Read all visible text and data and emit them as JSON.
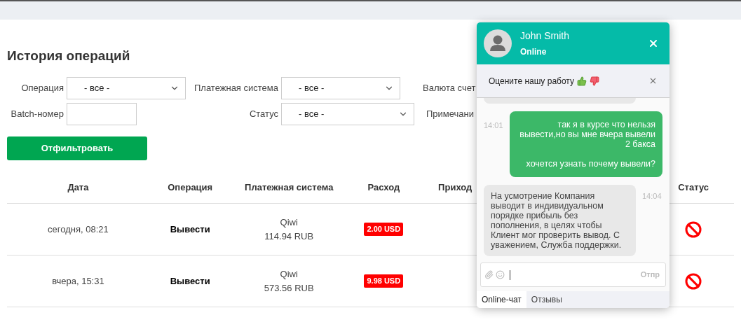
{
  "page": {
    "title": "История операций"
  },
  "filters": [
    {
      "label": "Операция",
      "kind": "select",
      "value": "- все -"
    },
    {
      "label": "Платежная система",
      "kind": "select",
      "value": "- все -"
    },
    {
      "label": "Валюта счет",
      "kind": "cut"
    },
    {
      "label": "Batch-номер",
      "kind": "input"
    },
    {
      "label": "Статус",
      "kind": "select",
      "value": "- все -"
    },
    {
      "label": "Примечани",
      "kind": "cut"
    }
  ],
  "filter_button": "Отфильтровать",
  "table": {
    "columns": [
      "Дата",
      "Операция",
      "Платежная система",
      "Расход",
      "Приход",
      "Статус"
    ],
    "rows": [
      {
        "date": "сегодня, 08:21",
        "operation": "Вывести",
        "system": "Qiwi",
        "system_amount": "114.94 RUB",
        "expense": "2.00 USD",
        "rejected": true
      },
      {
        "date": "вчера, 15:31",
        "operation": "Вывести",
        "system": "Qiwi",
        "system_amount": "573.56 RUB",
        "expense": "9.98 USD",
        "rejected": true
      }
    ]
  },
  "chat": {
    "agent": "John Smith",
    "presence": "Online",
    "rating": {
      "prompt": "Оцените нашу работу"
    },
    "messages": [
      {
        "kind": "cut"
      },
      {
        "kind": "outgoing",
        "time": "14:01",
        "lines": [
          "так я в курсе что нельзя вывести,но вы мне вчера вывели 2 бакса",
          "хочется узнать почему вывели?"
        ]
      },
      {
        "kind": "incoming",
        "time": "14:04",
        "lines": [
          "На усмотрение Компания выводит в индивидуальном порядке прибыль без пополнения, в целях чтобы Клиент мог проверить вывод. С уважением, Служба поддержки."
        ]
      }
    ],
    "send": "Отпр",
    "tabs": [
      {
        "label": "Online-чат",
        "selected": true
      },
      {
        "label": "Отзывы",
        "selected": false
      }
    ]
  }
}
